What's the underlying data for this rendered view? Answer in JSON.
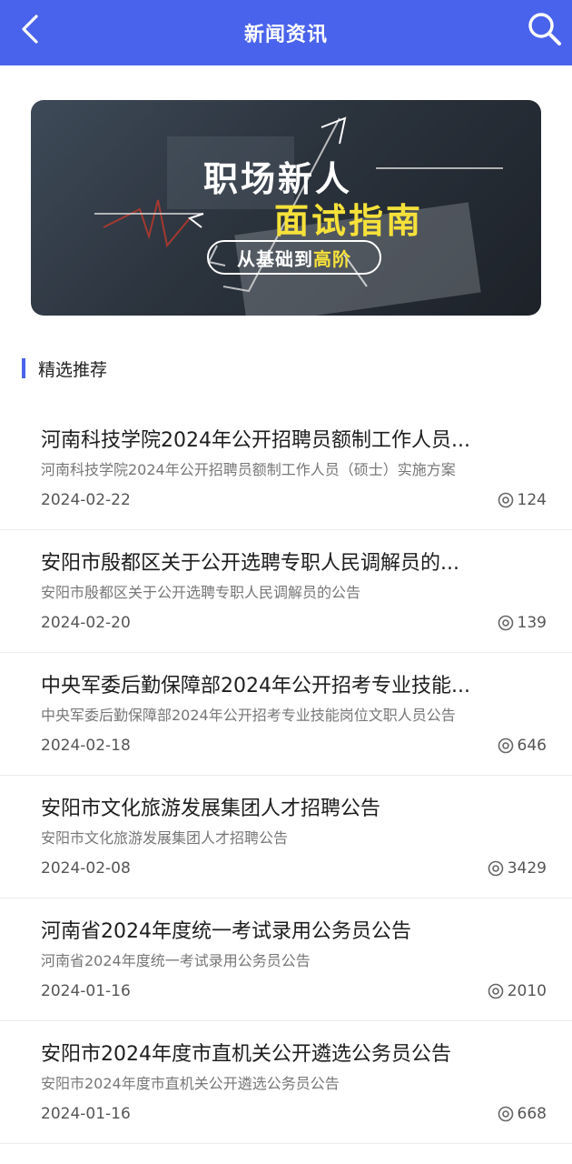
{
  "header": {
    "title": "新闻资讯",
    "back_icon": "chevron-left-icon",
    "search_icon": "search-icon",
    "bg_color": "#4a63ec"
  },
  "banner": {
    "line1": "职场新人",
    "line2": "面试指南",
    "pill_part1": "从基础到",
    "pill_part2": "高阶"
  },
  "section": {
    "title": "精选推荐",
    "accent_color": "#4a63ec"
  },
  "articles": [
    {
      "title": "河南科技学院2024年公开招聘员额制工作人员...",
      "subtitle": "河南科技学院2024年公开招聘员额制工作人员（硕士）实施方案",
      "date": "2024-02-22",
      "views": "124"
    },
    {
      "title": "安阳市殷都区关于公开选聘专职人民调解员的...",
      "subtitle": "安阳市殷都区关于公开选聘专职人民调解员的公告",
      "date": "2024-02-20",
      "views": "139"
    },
    {
      "title": "中央军委后勤保障部2024年公开招考专业技能...",
      "subtitle": "中央军委后勤保障部2024年公开招考专业技能岗位文职人员公告",
      "date": "2024-02-18",
      "views": "646"
    },
    {
      "title": "安阳市文化旅游发展集团人才招聘公告",
      "subtitle": "安阳市文化旅游发展集团人才招聘公告",
      "date": "2024-02-08",
      "views": "3429"
    },
    {
      "title": "河南省2024年度统一考试录用公务员公告",
      "subtitle": "河南省2024年度统一考试录用公务员公告",
      "date": "2024-01-16",
      "views": "2010"
    },
    {
      "title": "安阳市2024年度市直机关公开遴选公务员公告",
      "subtitle": "安阳市2024年度市直机关公开遴选公务员公告",
      "date": "2024-01-16",
      "views": "668"
    }
  ]
}
